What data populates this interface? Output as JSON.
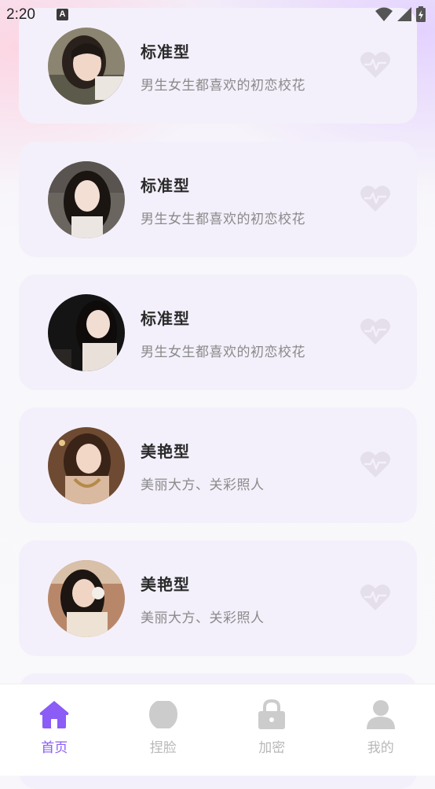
{
  "status_bar": {
    "time": "2:20",
    "notification_icon_letter": "A"
  },
  "cards": [
    {
      "title": "标准型",
      "subtitle": "男生女生都喜欢的初恋校花",
      "avatar": "girl-portrait-1"
    },
    {
      "title": "标准型",
      "subtitle": "男生女生都喜欢的初恋校花",
      "avatar": "girl-portrait-2"
    },
    {
      "title": "标准型",
      "subtitle": "男生女生都喜欢的初恋校花",
      "avatar": "girl-portrait-3"
    },
    {
      "title": "美艳型",
      "subtitle": "美丽大方、关彩照人",
      "avatar": "girl-portrait-4"
    },
    {
      "title": "美艳型",
      "subtitle": "美丽大方、关彩照人",
      "avatar": "girl-portrait-5"
    }
  ],
  "tabs": [
    {
      "label": "首页",
      "icon": "home-icon",
      "active": true
    },
    {
      "label": "捏脸",
      "icon": "face-icon",
      "active": false
    },
    {
      "label": "加密",
      "icon": "lock-icon",
      "active": false
    },
    {
      "label": "我的",
      "icon": "user-icon",
      "active": false
    }
  ],
  "colors": {
    "accent": "#8b5cf6",
    "inactive": "#c8c8c8",
    "card_bg": "#f4f0fb",
    "heart": "#e2dce8"
  }
}
